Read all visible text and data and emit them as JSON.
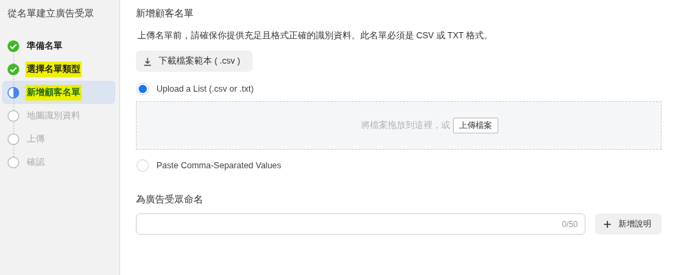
{
  "sidebar": {
    "title": "從名單建立廣告受眾",
    "steps": [
      {
        "label": "準備名單",
        "completed": true,
        "current": false,
        "highlighted": false,
        "selected": false
      },
      {
        "label": "選擇名單類型",
        "completed": true,
        "current": false,
        "highlighted": true,
        "selected": false
      },
      {
        "label": "新增顧客名單",
        "completed": false,
        "current": true,
        "highlighted": true,
        "selected": true
      },
      {
        "label": "地圖識別資料",
        "completed": false,
        "current": false,
        "highlighted": false,
        "selected": false
      },
      {
        "label": "上傳",
        "completed": false,
        "current": false,
        "highlighted": false,
        "selected": false
      },
      {
        "label": "確認",
        "completed": false,
        "current": false,
        "highlighted": false,
        "selected": false
      }
    ]
  },
  "main": {
    "title": "新增顧客名單",
    "description": "上傳名單前，請確保你提供充足且格式正確的識別資料。此名單必須是 CSV 或 TXT 格式。",
    "download_button": "下載檔案範本 ( .csv )",
    "options": [
      {
        "label": "Upload a List (.csv or .txt)",
        "selected": true
      },
      {
        "label": "Paste Comma-Separated Values",
        "selected": false
      }
    ],
    "dropzone": {
      "text": "將檔案拖放到這裡，或",
      "button": "上傳檔案"
    },
    "name_section": {
      "label": "為廣告受眾命名",
      "counter": "0/50",
      "add_button": "新增說明"
    }
  }
}
